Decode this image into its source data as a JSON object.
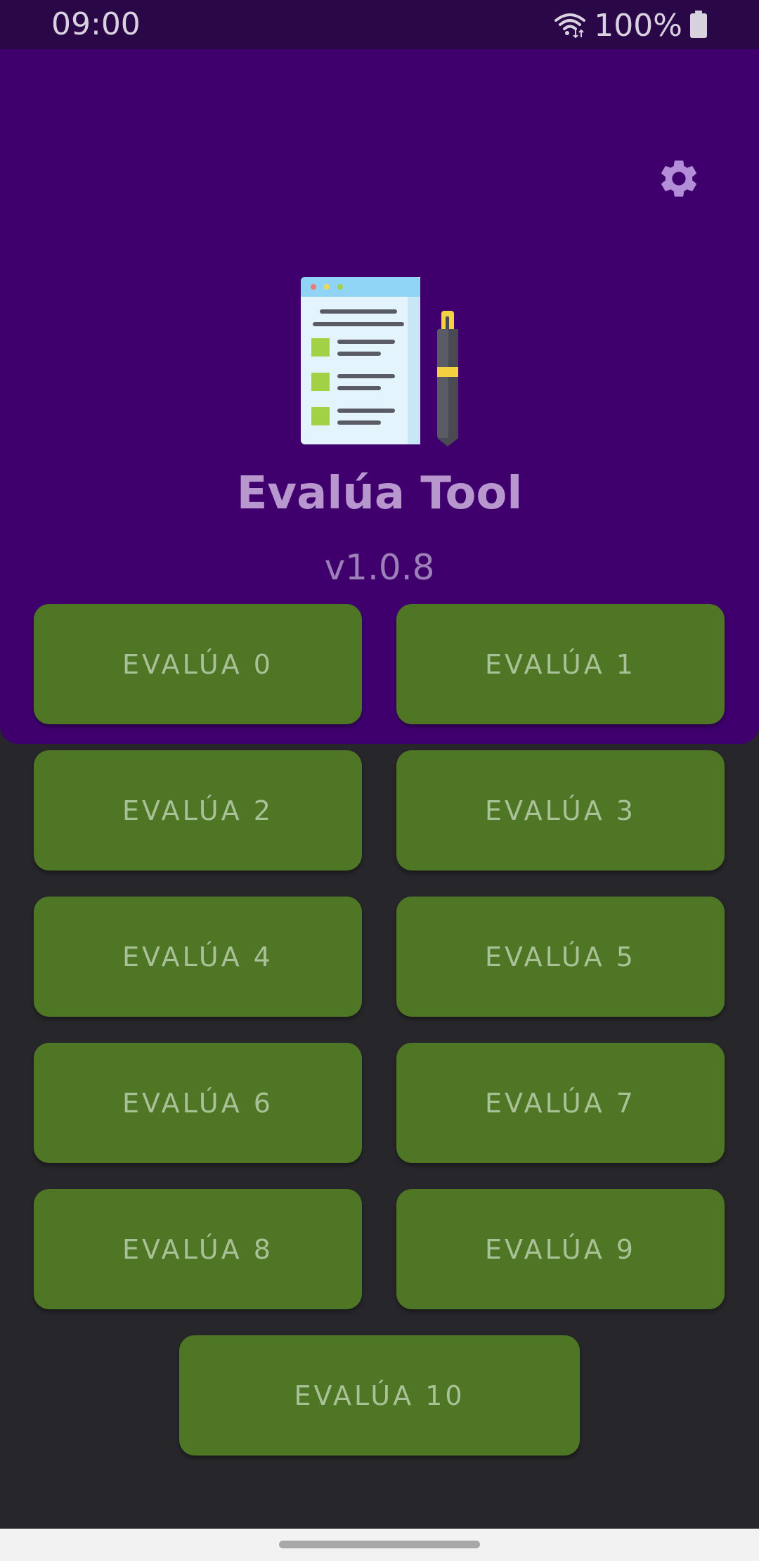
{
  "status_bar": {
    "time": "09:00",
    "battery": "100%",
    "icons": [
      "wifi-icon",
      "battery-icon"
    ]
  },
  "header": {
    "settings_icon": "gear-icon",
    "logo_icon": "checklist-with-pen-icon",
    "title": "Evalúa Tool",
    "version": "v1.0.8"
  },
  "buttons": [
    {
      "label": "EVALÚA 0"
    },
    {
      "label": "EVALÚA 1"
    },
    {
      "label": "EVALÚA 2"
    },
    {
      "label": "EVALÚA 3"
    },
    {
      "label": "EVALÚA 4"
    },
    {
      "label": "EVALÚA 5"
    },
    {
      "label": "EVALÚA 6"
    },
    {
      "label": "EVALÚA 7"
    },
    {
      "label": "EVALÚA 8"
    },
    {
      "label": "EVALÚA 9"
    },
    {
      "label": "EVALÚA 10"
    }
  ],
  "colors": {
    "status_bar": "#2a0848",
    "header": "#3f006d",
    "background": "#27262a",
    "button": "#4e7624",
    "button_text": "#a9c196",
    "title_text": "#b897cf",
    "settings_icon": "#b38dd8"
  }
}
